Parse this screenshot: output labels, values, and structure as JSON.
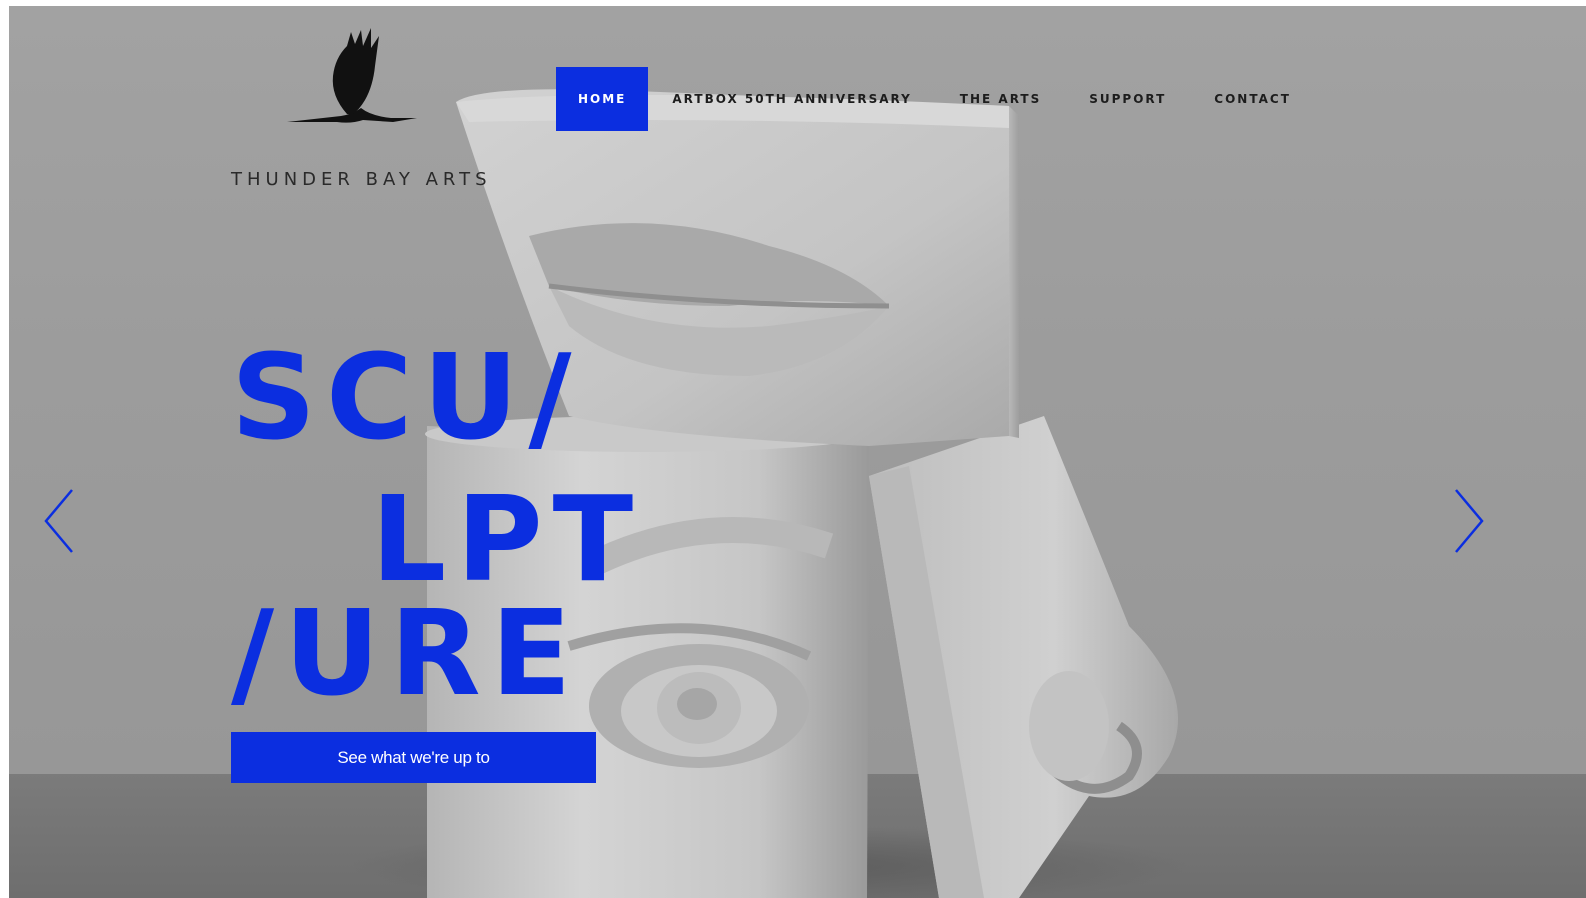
{
  "logo": {
    "text": "THUNDER BAY ARTS",
    "icon": "heron-bird-icon"
  },
  "nav": {
    "items": [
      {
        "label": "HOME",
        "active": true
      },
      {
        "label": "ARTBOX 50TH ANNIVERSARY",
        "active": false
      },
      {
        "label": "THE ARTS",
        "active": false
      },
      {
        "label": "SUPPORT",
        "active": false
      },
      {
        "label": "CONTACT",
        "active": false
      }
    ]
  },
  "hero": {
    "headline": {
      "line1": "SCU/",
      "line2": "LPT",
      "line3": "/URE"
    },
    "cta_label": "See what we're up to",
    "prev_icon": "chevron-left-icon",
    "next_icon": "chevron-right-icon"
  },
  "colors": {
    "accent": "#0b2ee0",
    "text_dark": "#1d1d1d",
    "background": "#9c9c9c"
  }
}
